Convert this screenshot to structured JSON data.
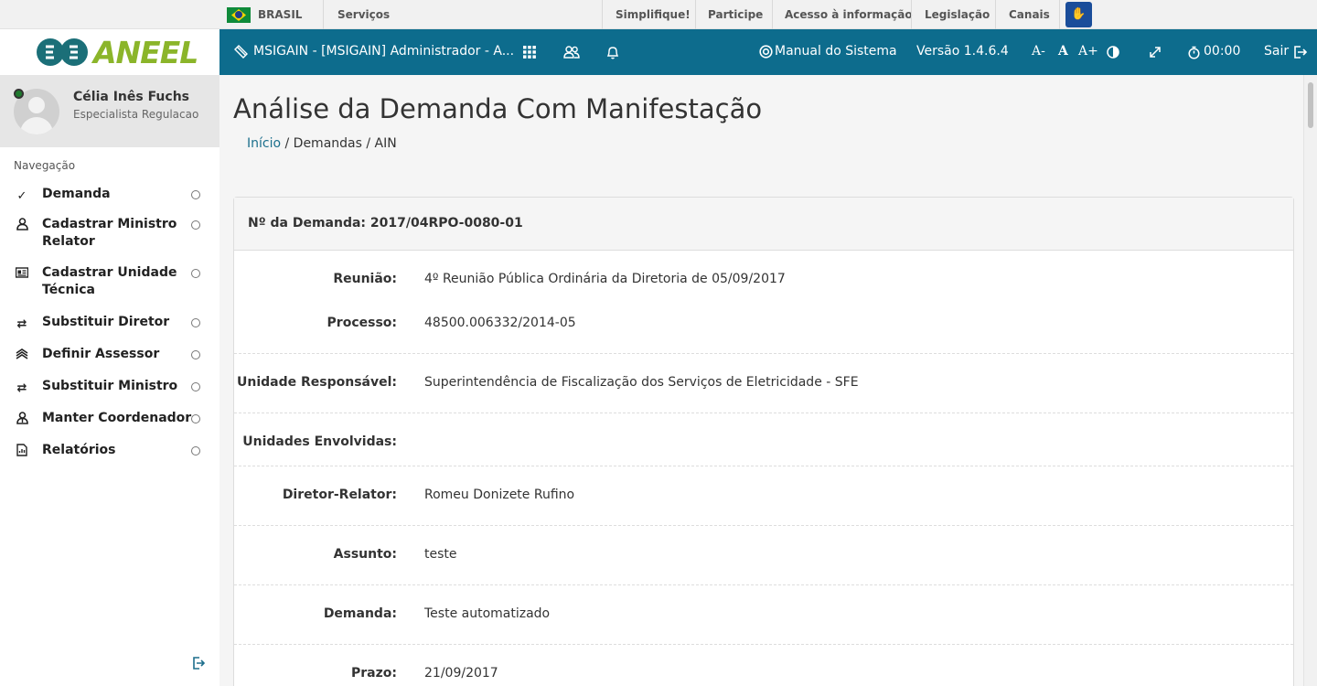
{
  "gov_bar": {
    "country": "BRASIL",
    "services": "Serviços",
    "links": [
      "Simplifique!",
      "Participe",
      "Acesso à informação",
      "Legislação",
      "Canais"
    ]
  },
  "logo": {
    "text": "ANEEL"
  },
  "user": {
    "name": "Célia Inês Fuchs",
    "role": "Especialista Regulacao",
    "status_color": "#1f7a2e"
  },
  "nav": {
    "title": "Navegação",
    "items": [
      {
        "label": "Demanda",
        "icon": "check-icon"
      },
      {
        "label": "Cadastrar Ministro Relator",
        "icon": "user-icon"
      },
      {
        "label": "Cadastrar Unidade Técnica",
        "icon": "id-card-icon"
      },
      {
        "label": "Substituir Diretor",
        "icon": "swap-icon"
      },
      {
        "label": "Definir Assessor",
        "icon": "layers-icon"
      },
      {
        "label": "Substituir Ministro",
        "icon": "swap-icon"
      },
      {
        "label": "Manter Coordenador",
        "icon": "user-tie-icon"
      },
      {
        "label": "Relatórios",
        "icon": "report-icon"
      }
    ]
  },
  "header": {
    "app_title": "MSIGAIN - [MSIGAIN] Administrador - A...",
    "manual": "Manual do Sistema",
    "version": "Versão 1.4.6.4",
    "font_decrease": "A-",
    "font_normal": "A",
    "font_increase": "A+",
    "timer": "00:00",
    "logout": "Sair",
    "color": "#0d6c8d"
  },
  "page": {
    "title": "Análise da Demanda Com Manifestação",
    "breadcrumb": {
      "home": "Início",
      "rest": " / Demandas / AIN"
    }
  },
  "demand": {
    "header": "Nº da Demanda: 2017/04RPO-0080-01",
    "fields": [
      {
        "label": "Reunião:",
        "value": "4º Reunião Pública Ordinária da Diretoria de 05/09/2017"
      },
      {
        "label": "Processo:",
        "value": "48500.006332/2014-05"
      },
      {
        "label": "Unidade Responsável:",
        "value": "Superintendência de Fiscalização dos Serviços de Eletricidade - SFE"
      },
      {
        "label": "Unidades Envolvidas:",
        "value": ""
      },
      {
        "label": "Diretor-Relator:",
        "value": "Romeu Donizete Rufino"
      },
      {
        "label": "Assunto:",
        "value": "teste"
      },
      {
        "label": "Demanda:",
        "value": "Teste automatizado"
      },
      {
        "label": "Prazo:",
        "value": "21/09/2017"
      }
    ]
  }
}
